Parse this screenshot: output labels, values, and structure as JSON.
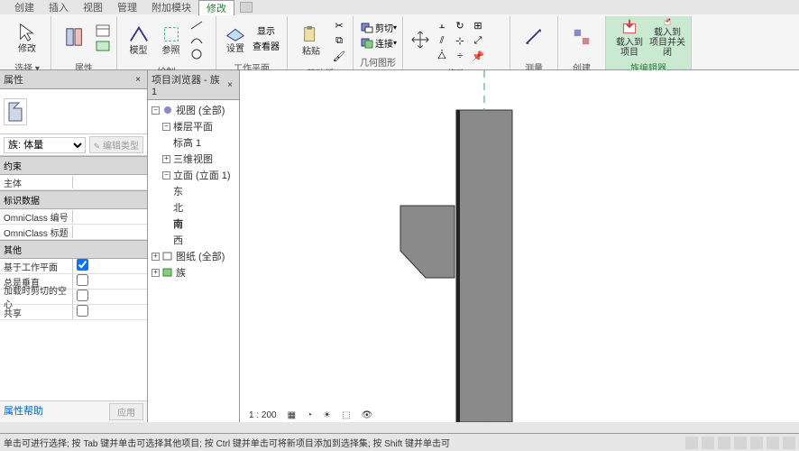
{
  "menu": {
    "items": [
      "创建",
      "插入",
      "视图",
      "管理",
      "附加模块",
      "修改"
    ],
    "active": "修改"
  },
  "ribbon": {
    "groups": [
      {
        "label": "选择",
        "big": [
          {
            "label": "修改",
            "key": "modify"
          }
        ],
        "smallArrow": true
      },
      {
        "label": "属性",
        "big": [
          {
            "label": "",
            "key": "properties"
          }
        ]
      },
      {
        "label": "剪贴板",
        "big": [
          {
            "label": "粘贴",
            "key": "paste"
          }
        ]
      },
      {
        "label": "几何图形",
        "big": [
          {
            "label": "剪切",
            "key": "cut"
          },
          {
            "label": "连接",
            "key": "join"
          }
        ]
      },
      {
        "label": "修改",
        "big": []
      },
      {
        "label": "测量",
        "big": []
      },
      {
        "label": "创建",
        "big": []
      },
      {
        "label": "族编辑器",
        "big": [
          {
            "label": "载入到\n项目",
            "key": "loadproject"
          },
          {
            "label": "载入到\n项目并关闭",
            "key": "loadclose"
          }
        ],
        "active": true
      }
    ],
    "draw_panel_label": "绘制",
    "workplane_label": "工作平面",
    "modelBtn": "模型",
    "refBtn": "参照",
    "showBtn": "显示",
    "viewerBtn": "查看器"
  },
  "props": {
    "title": "属性",
    "family": "族: 体量",
    "edit_type": "编辑类型",
    "help": "属性帮助",
    "apply": "应用",
    "cats": [
      {
        "name": "约束",
        "rows": [
          {
            "name": "主体",
            "val": ""
          }
        ]
      },
      {
        "name": "标识数据",
        "rows": [
          {
            "name": "OmniClass 编号",
            "val": ""
          },
          {
            "name": "OmniClass 标题",
            "val": ""
          }
        ]
      },
      {
        "name": "其他",
        "rows": [
          {
            "name": "基于工作平面",
            "checked": true
          },
          {
            "name": "总是垂直",
            "checked": false
          },
          {
            "name": "加载时剪切的空心",
            "checked": false
          },
          {
            "name": "共享",
            "checked": false
          }
        ]
      }
    ]
  },
  "browser": {
    "title": "项目浏览器 - 族1",
    "tree": [
      {
        "lvl": 1,
        "exp": true,
        "label": "视图 (全部)",
        "icon": "folder"
      },
      {
        "lvl": 2,
        "exp": true,
        "label": "楼层平面"
      },
      {
        "lvl": 3,
        "label": "标高 1"
      },
      {
        "lvl": 2,
        "exp": true,
        "label": "三维视图"
      },
      {
        "lvl": 2,
        "exp": true,
        "label": "立面 (立面 1)"
      },
      {
        "lvl": 3,
        "label": "东"
      },
      {
        "lvl": 3,
        "label": "北"
      },
      {
        "lvl": 3,
        "label": "南",
        "bold": true
      },
      {
        "lvl": 3,
        "label": "西"
      },
      {
        "lvl": 1,
        "exp": false,
        "label": "图纸 (全部)",
        "icon": "sheet"
      },
      {
        "lvl": 1,
        "exp": false,
        "label": "族",
        "icon": "fam"
      }
    ]
  },
  "canvas": {
    "scale": "1 : 200"
  },
  "status": {
    "hint": "单击可进行选择; 按 Tab 键并单击可选择其他项目; 按 Ctrl 键并单击可将新项目添加到选择集; 按 Shift 键并单击可"
  }
}
